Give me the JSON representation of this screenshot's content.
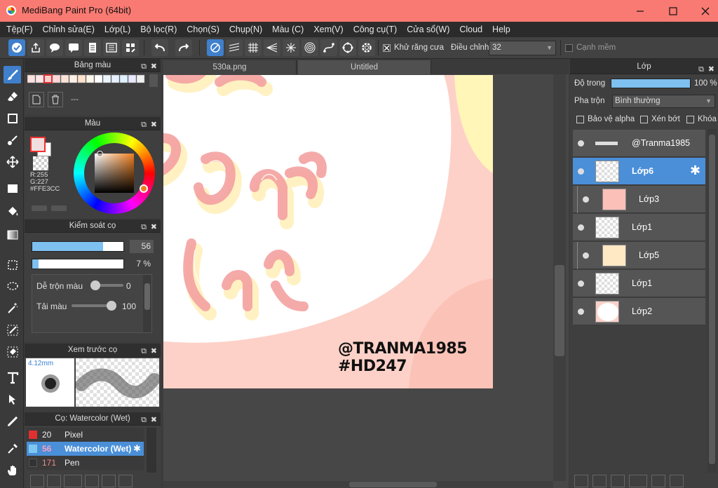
{
  "app": {
    "title": "MediBang Paint Pro (64bit)"
  },
  "menu": [
    "Tệp(F)",
    "Chỉnh sửa(E)",
    "Lớp(L)",
    "Bộ lọc(R)",
    "Chọn(S)",
    "Chụp(N)",
    "Màu (C)",
    "Xem(V)",
    "Công cụ(T)",
    "Cửa sổ(W)",
    "Cloud",
    "Help"
  ],
  "toolbar": {
    "antialias_label": "Khử răng cưa",
    "adjust_label": "Điều chỉnh",
    "adjust_value": "32",
    "soft_edge_label": "Cạnh mềm"
  },
  "palette_panel": {
    "title": "Bảng màu",
    "name_value": "---"
  },
  "color_panel": {
    "title": "Màu",
    "r": "R:255",
    "g": "G:227",
    "hex": "#FFE3CC",
    "fg_color": "#f06060",
    "bg_color": "#ffffff"
  },
  "brush_control": {
    "title": "Kiểm soát cọ",
    "size_value": "56",
    "size_fraction": 0.78,
    "opacity_value": "7 %",
    "opacity_fraction": 0.07,
    "blend_label": "Dễ trộn màu",
    "blend_value": "0",
    "load_label": "Tải màu",
    "load_value": "100"
  },
  "brush_preview": {
    "title": "Xem trước cọ",
    "size_label": "4.12mm"
  },
  "brush_list": {
    "title": "Cọ: Watercolor (Wet)",
    "items": [
      {
        "size": "20",
        "name": "Pixel",
        "color": "#e03030"
      },
      {
        "size": "56",
        "name": "Watercolor (Wet)",
        "color": "#7ec8f0"
      },
      {
        "size": "171",
        "name": "Pen",
        "color": "#333333"
      }
    ]
  },
  "tabs": [
    "530a.png",
    "Untitled"
  ],
  "canvas": {
    "watermark_line1": "@TRANMA1985",
    "watermark_line2": "#HD247"
  },
  "layer_panel": {
    "title": "Lớp",
    "opacity_label": "Độ trong",
    "opacity_value": "100 %",
    "blend_label": "Pha trộn",
    "blend_value": "Bình thường",
    "protect_alpha": "Bảo vệ alpha",
    "clipping": "Xén bớt",
    "lock": "Khóa",
    "layers": [
      {
        "name": "@Tranma1985"
      },
      {
        "name": "Lớp6"
      },
      {
        "name": "Lớp3"
      },
      {
        "name": "Lớp1"
      },
      {
        "name": "Lớp5"
      },
      {
        "name": "Lớp1"
      },
      {
        "name": "Lớp2"
      }
    ]
  }
}
